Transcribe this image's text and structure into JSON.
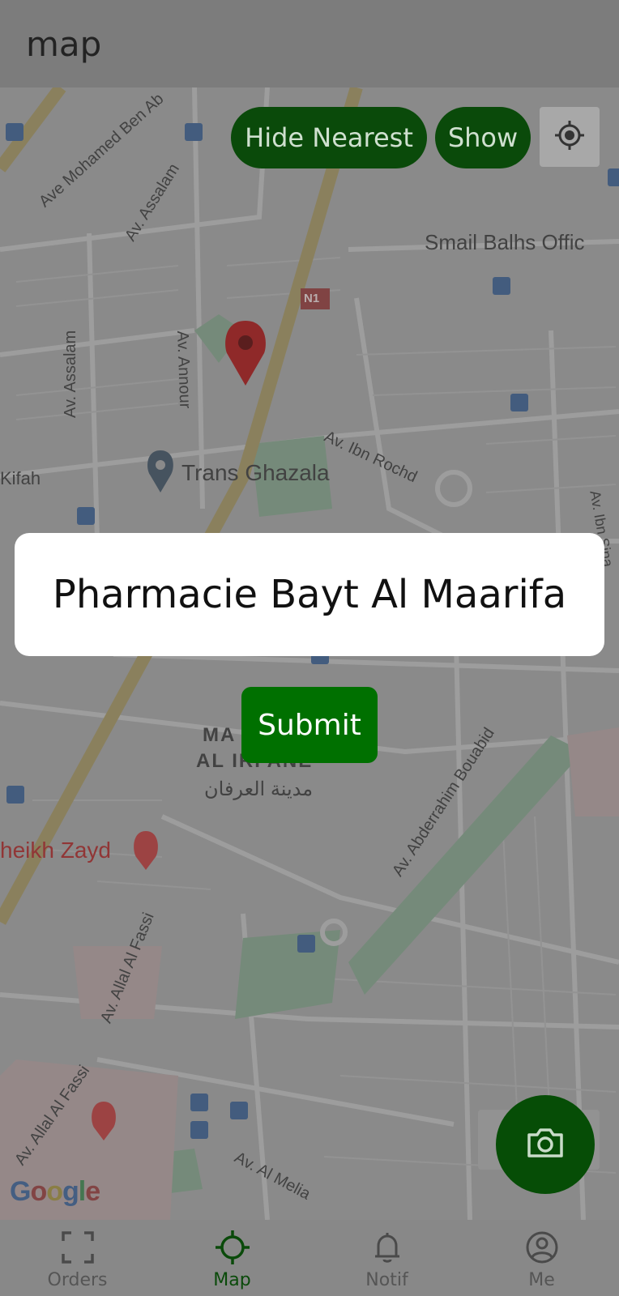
{
  "header": {
    "title": "map"
  },
  "map": {
    "controls": {
      "hide_nearest_label": "Hide Nearest",
      "show_label": "Show",
      "locate_icon": "crosshair-locate-icon"
    },
    "labels": {
      "ave_mohamed": "Ave Mohamed Ben Ab",
      "av_assalam_1": "Av. Assalam",
      "av_assalam_2": "Av. Assalam",
      "smail": "Smail Balhs Offic",
      "n1": "N1",
      "av_annour": "Av. Annour",
      "av_ibn_rochd": "Av. Ibn Rochd",
      "kifah": "Kifah",
      "trans_ghazala": "Trans Ghazala",
      "av_ibn_sina": "Av. Ibn Sina",
      "ma": "MA",
      "al_irfane": "AL IRFANE",
      "al_irfane_ar": "مدينة العرفان",
      "abderrahim": "Av. Abderrahim Bouabid",
      "sheikh_zayd": "heikh Zayd",
      "allal_fassi_1": "Av. Allal Al Fassi",
      "allal_fassi_2": "Av. Allal Al Fassi",
      "al_melia": "Av. Al Melia",
      "google": "Google"
    }
  },
  "dialog": {
    "text": "Pharmacie Bayt Al Maarifa"
  },
  "submit_label": "Submit",
  "fab": {
    "icon": "camera-icon"
  },
  "bottom_nav": {
    "items": [
      {
        "label": "Orders",
        "icon": "scan-frame-icon",
        "active": false
      },
      {
        "label": "Map",
        "icon": "crosshair-icon",
        "active": true
      },
      {
        "label": "Notif",
        "icon": "bell-icon",
        "active": false
      },
      {
        "label": "Me",
        "icon": "account-icon",
        "active": false
      }
    ]
  },
  "colors": {
    "brand_green": "#007000",
    "dark_green": "#0a4a0a",
    "marker_red": "#a01818"
  }
}
